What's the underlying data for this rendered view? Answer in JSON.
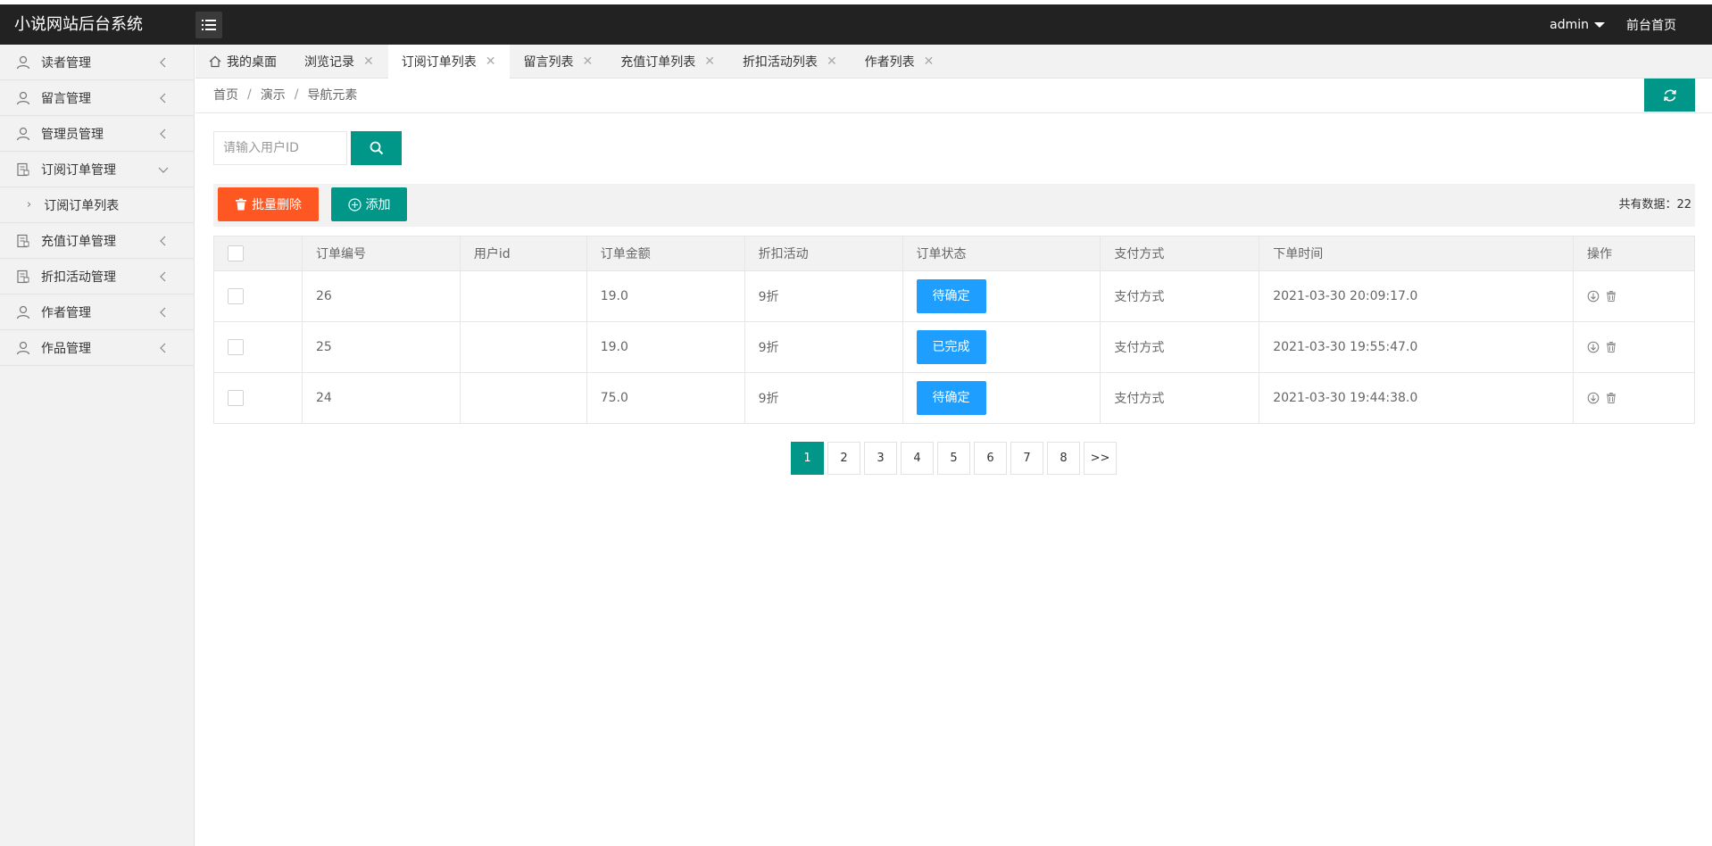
{
  "header": {
    "app_title": "小说网站后台系统",
    "user": "admin",
    "frontend_link": "前台首页"
  },
  "sidebar": {
    "items": [
      {
        "label": "读者管理",
        "icon": "user-icon"
      },
      {
        "label": "留言管理",
        "icon": "user-icon"
      },
      {
        "label": "管理员管理",
        "icon": "user-icon"
      },
      {
        "label": "订阅订单管理",
        "icon": "document-icon",
        "expanded": true
      },
      {
        "label": "订阅订单列表",
        "sub": true
      },
      {
        "label": "充值订单管理",
        "icon": "document-icon"
      },
      {
        "label": "折扣活动管理",
        "icon": "document-icon"
      },
      {
        "label": "作者管理",
        "icon": "user-icon"
      },
      {
        "label": "作品管理",
        "icon": "user-icon"
      }
    ]
  },
  "tabs": [
    {
      "label": "我的桌面",
      "home": true
    },
    {
      "label": "浏览记录"
    },
    {
      "label": "订阅订单列表",
      "active": true
    },
    {
      "label": "留言列表"
    },
    {
      "label": "充值订单列表"
    },
    {
      "label": "折扣活动列表"
    },
    {
      "label": "作者列表"
    }
  ],
  "breadcrumb": [
    "首页",
    "演示",
    "导航元素"
  ],
  "search": {
    "placeholder": "请输入用户ID"
  },
  "toolbar": {
    "delete_label": "批量删除",
    "add_label": "添加",
    "total_label": "共有数据：22"
  },
  "table": {
    "columns": [
      "订单编号",
      "用户id",
      "订单金额",
      "折扣活动",
      "订单状态",
      "支付方式",
      "下单时间",
      "操作"
    ],
    "rows": [
      {
        "id": "26",
        "user_id": "",
        "amount": "19.0",
        "discount": "9折",
        "status": "待确定",
        "payment": "支付方式",
        "time": "2021-03-30 20:09:17.0"
      },
      {
        "id": "25",
        "user_id": "",
        "amount": "19.0",
        "discount": "9折",
        "status": "已完成",
        "payment": "支付方式",
        "time": "2021-03-30 19:55:47.0"
      },
      {
        "id": "24",
        "user_id": "",
        "amount": "75.0",
        "discount": "9折",
        "status": "待确定",
        "payment": "支付方式",
        "time": "2021-03-30 19:44:38.0"
      }
    ]
  },
  "pagination": {
    "pages": [
      "1",
      "2",
      "3",
      "4",
      "5",
      "6",
      "7",
      "8"
    ],
    "next": ">>",
    "current": "1"
  },
  "colors": {
    "accent": "#009688",
    "danger": "#ff5722",
    "status_blue": "#1e9fff",
    "topbar": "#222222"
  }
}
